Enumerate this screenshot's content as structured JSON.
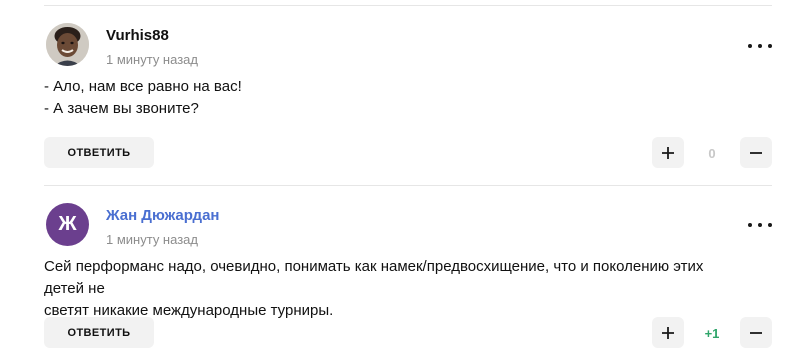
{
  "comments": [
    {
      "author": "Vurhis88",
      "time": "1 минуту назад",
      "text": "- Ало, нам все равно на вас!\n- А зачем вы звоните?",
      "reply_label": "ОТВЕТИТЬ",
      "score": "0",
      "avatar_icon": "child-photo-avatar"
    },
    {
      "author": "Жан Дюжардан",
      "avatar_letter": "Ж",
      "time": "1 минуту назад",
      "text": "Сей перформанс надо, очевидно, понимать как намек/предвосхищение, что и поколению этих детей не\nсветят никакие международные турниры.",
      "reply_label": "ОТВЕТИТЬ",
      "score": "+1",
      "avatar_color": "#6b3f8e",
      "author_color": "#4a6fd1",
      "score_color": "#2fa56a"
    }
  ]
}
